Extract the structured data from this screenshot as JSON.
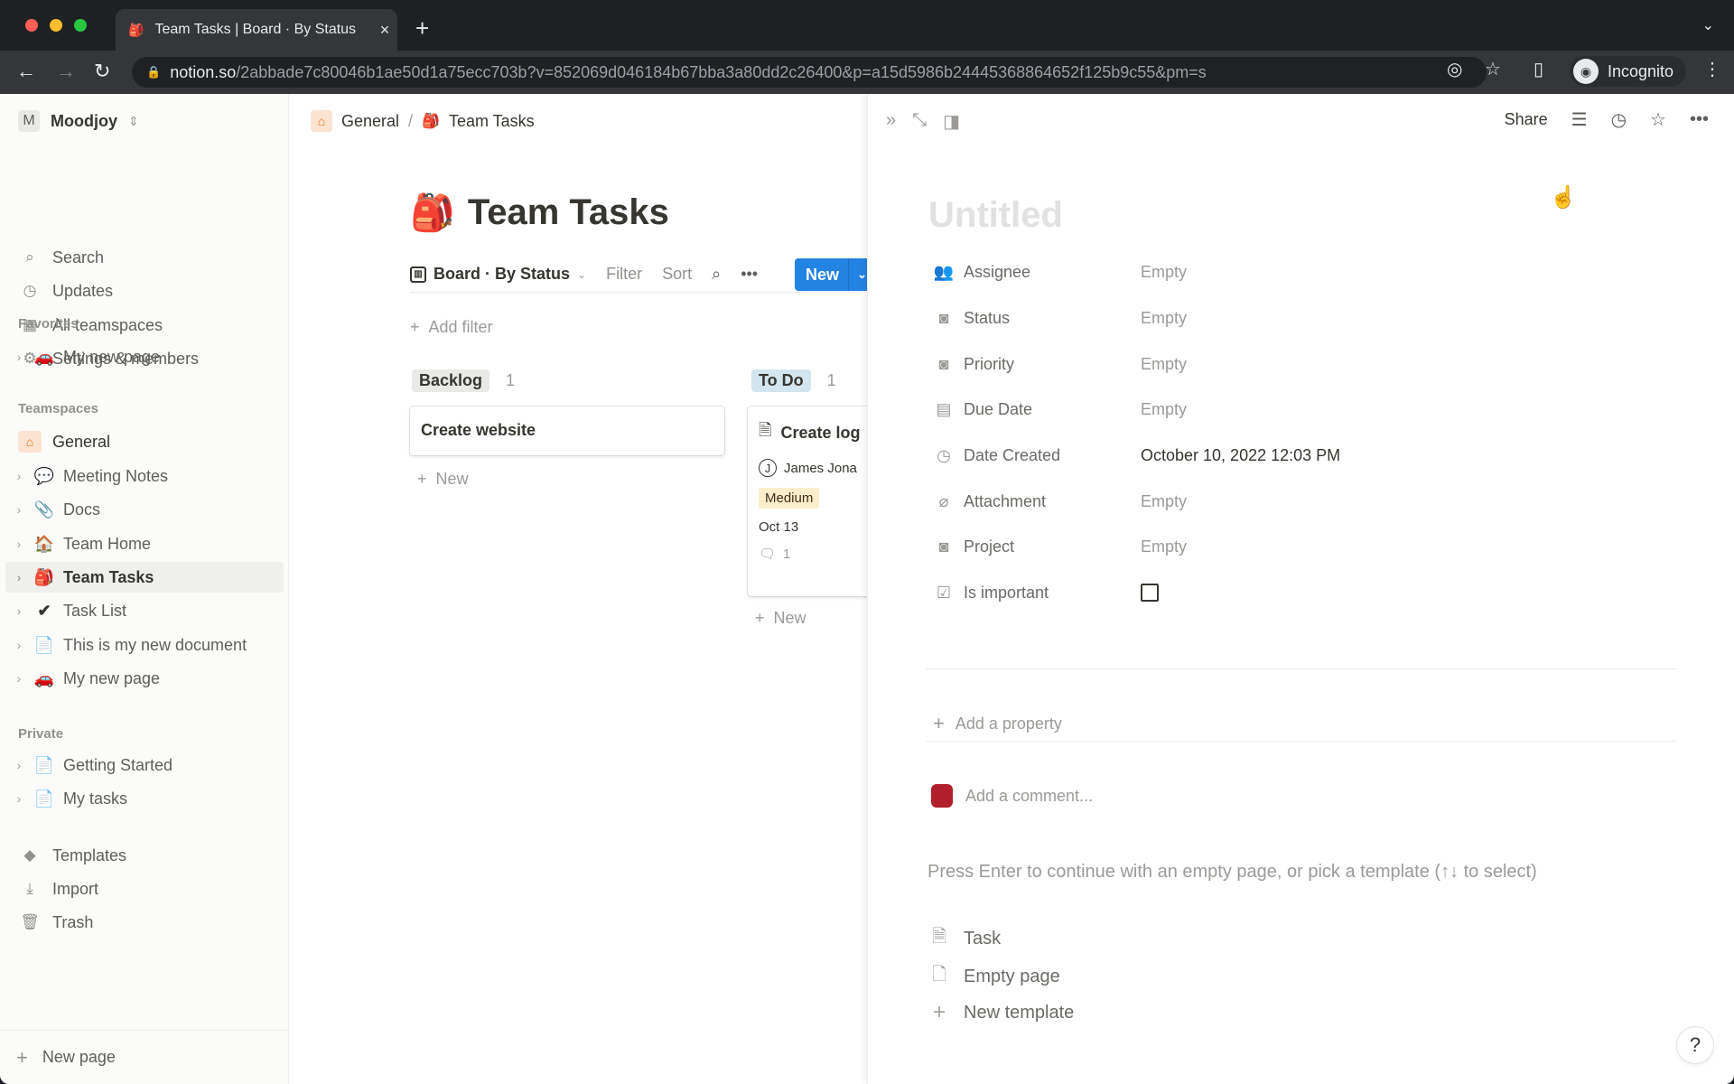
{
  "browser": {
    "tab_title": "Team Tasks | Board · By Status",
    "url_host": "notion.so",
    "url_path": "/2abbade7c80046b1ae50d1a75ecc703b?v=852069d046184b67bba3a80dd2c26400&p=a15d5986b24445368864652f125b9c55&pm=s",
    "profile_label": "Incognito"
  },
  "sidebar": {
    "workspace_initial": "M",
    "workspace_name": "Moodjoy",
    "nav": [
      {
        "label": "Search",
        "icon": "search-icon"
      },
      {
        "label": "Updates",
        "icon": "clock-icon"
      },
      {
        "label": "All teamspaces",
        "icon": "building-icon"
      },
      {
        "label": "Settings & members",
        "icon": "gear-icon"
      }
    ],
    "favorites_heading": "Favorites",
    "favorites": [
      {
        "label": "My new page",
        "emoji": "🚗"
      }
    ],
    "teamspaces_heading": "Teamspaces",
    "teamspace_name": "General",
    "teamspace_pages": [
      {
        "label": "Meeting Notes",
        "emoji": "💬"
      },
      {
        "label": "Docs",
        "emoji": "📎"
      },
      {
        "label": "Team Home",
        "emoji": "🏠"
      },
      {
        "label": "Team Tasks",
        "emoji": "🎒",
        "active": true
      },
      {
        "label": "Task List",
        "emoji": "✔"
      },
      {
        "label": "This is my new document",
        "emoji": "📄"
      },
      {
        "label": "My new page",
        "emoji": "🚗"
      }
    ],
    "private_heading": "Private",
    "private_pages": [
      {
        "label": "Getting Started",
        "emoji": "📄"
      },
      {
        "label": "My tasks",
        "emoji": "📄"
      }
    ],
    "tools": [
      {
        "label": "Templates",
        "icon": "templates-icon"
      },
      {
        "label": "Import",
        "icon": "import-icon"
      },
      {
        "label": "Trash",
        "icon": "trash-icon"
      }
    ],
    "new_page_label": "New page"
  },
  "main": {
    "breadcrumb": [
      "General",
      "Team Tasks"
    ],
    "title": "Team Tasks",
    "view_name": "Board · By Status",
    "filter_label": "Filter",
    "sort_label": "Sort",
    "new_label": "New",
    "add_filter_label": "Add filter",
    "columns": [
      {
        "name": "Backlog",
        "count": "1",
        "color": "#e9e9e7",
        "cards": [
          {
            "title": "Create website"
          }
        ],
        "new_label": "New"
      },
      {
        "name": "To Do",
        "count": "1",
        "color": "#d3e5ef",
        "cards": [
          {
            "title": "Create log",
            "assignee_initial": "J",
            "assignee": "James Jona",
            "priority": "Medium",
            "due": "Oct 13",
            "comments": "1"
          }
        ],
        "new_label": "New"
      }
    ]
  },
  "peek": {
    "share_label": "Share",
    "title_placeholder": "Untitled",
    "properties": [
      {
        "name": "Assignee",
        "value": "Empty",
        "icon": "people-icon"
      },
      {
        "name": "Status",
        "value": "Empty",
        "icon": "select-icon"
      },
      {
        "name": "Priority",
        "value": "Empty",
        "icon": "select-icon"
      },
      {
        "name": "Due Date",
        "value": "Empty",
        "icon": "calendar-icon"
      },
      {
        "name": "Date Created",
        "value": "October 10, 2022 12:03 PM",
        "icon": "clock-icon"
      },
      {
        "name": "Attachment",
        "value": "Empty",
        "icon": "paperclip-icon"
      },
      {
        "name": "Project",
        "value": "Empty",
        "icon": "select-icon"
      },
      {
        "name": "Is important",
        "value": false,
        "icon": "checkbox-icon"
      }
    ],
    "add_property_label": "Add a property",
    "comment_placeholder": "Add a comment...",
    "hint": "Press Enter to continue with an empty page, or pick a template (↑↓ to select)",
    "templates": [
      {
        "label": "Task",
        "icon": "page-icon"
      },
      {
        "label": "Empty page",
        "icon": "empty-page-icon"
      },
      {
        "label": "New template",
        "icon": "plus-icon"
      }
    ],
    "help_label": "?"
  }
}
